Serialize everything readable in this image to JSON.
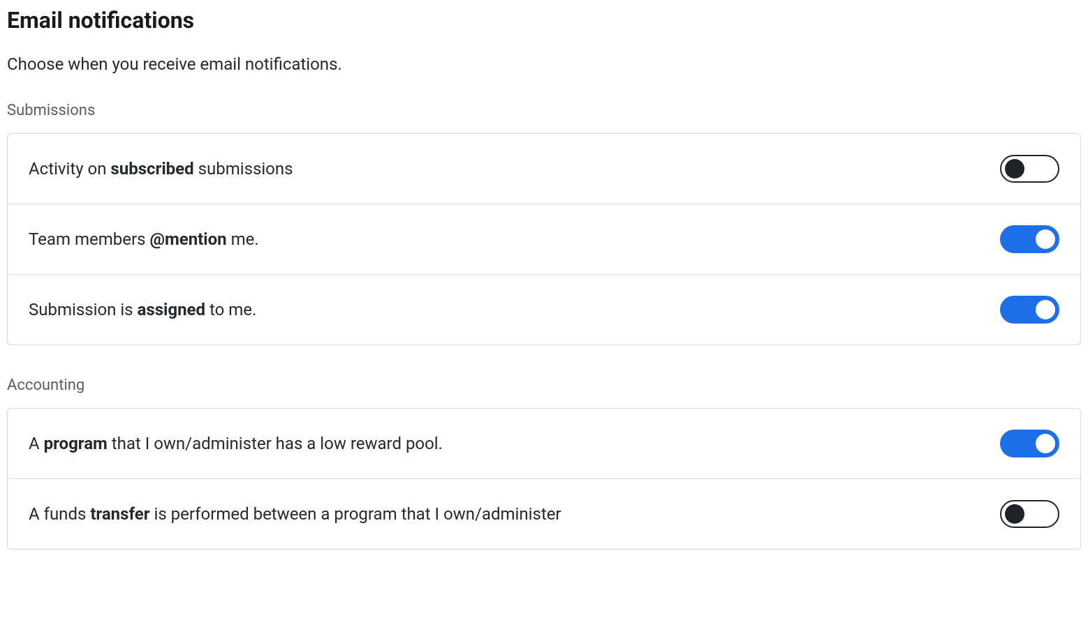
{
  "title": "Email notifications",
  "subtitle": "Choose when you receive email notifications.",
  "sections": [
    {
      "header": "Submissions",
      "items": [
        {
          "label_prefix": "Activity on ",
          "label_bold": "subscribed",
          "label_suffix": " submissions",
          "enabled": false,
          "name": "toggle-activity-subscribed"
        },
        {
          "label_prefix": "Team members ",
          "label_bold": "@mention",
          "label_suffix": " me.",
          "enabled": true,
          "name": "toggle-team-mention"
        },
        {
          "label_prefix": "Submission is ",
          "label_bold": "assigned",
          "label_suffix": " to me.",
          "enabled": true,
          "name": "toggle-submission-assigned"
        }
      ]
    },
    {
      "header": "Accounting",
      "items": [
        {
          "label_prefix": "A ",
          "label_bold": "program",
          "label_suffix": " that I own/administer has a low reward pool.",
          "enabled": true,
          "name": "toggle-program-low-reward"
        },
        {
          "label_prefix": "A funds ",
          "label_bold": "transfer",
          "label_suffix": " is performed between a program that I own/administer",
          "enabled": false,
          "name": "toggle-funds-transfer"
        }
      ]
    }
  ]
}
